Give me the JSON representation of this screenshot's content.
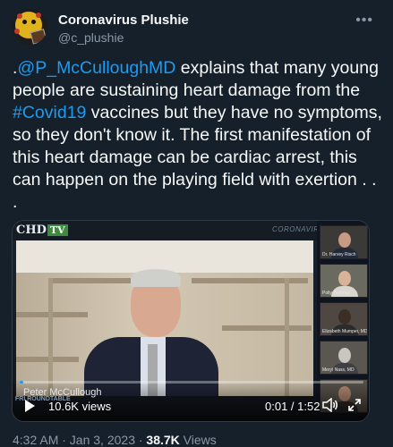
{
  "author": {
    "name": "Coronavirus Plushie",
    "handle": "@c_plushie",
    "avatar_icon": "plush-virus-avatar"
  },
  "more_icon": "more-horizontal-icon",
  "tweet": {
    "prefix": ".",
    "mention": "@P_McCulloughMD",
    "text_part1": " explains that many young people are sustaining heart damage from the ",
    "hashtag": "#Covid19",
    "text_part2": " vaccines but they have no symptoms, so they don't know it. The first manifestation of this heart damage can be cardiac arrest, this can happen on the playing field with exertion . . ."
  },
  "video": {
    "logo_chd": "CHD",
    "logo_tv": "TV",
    "watermark": "CORONAVIRUS",
    "speaker": "Peter McCullough",
    "views": "10.6K views",
    "time": "0:01 / 1:52",
    "progress": 0.01,
    "badge": "FRI ROUNDTABLE",
    "side_captions": [
      "Dr. Harvey Risch",
      "Polly Tommey",
      "Elizabeth Mumper, MD",
      "Meryl Nass, MD",
      ""
    ]
  },
  "footer": {
    "time": "4:32 AM · Jan 3, 2023 · ",
    "views_count": "38.7K",
    "views_label": " Views"
  },
  "colors": {
    "background": "#15202b",
    "link": "#1d9bf0",
    "secondary": "#8b98a5"
  }
}
